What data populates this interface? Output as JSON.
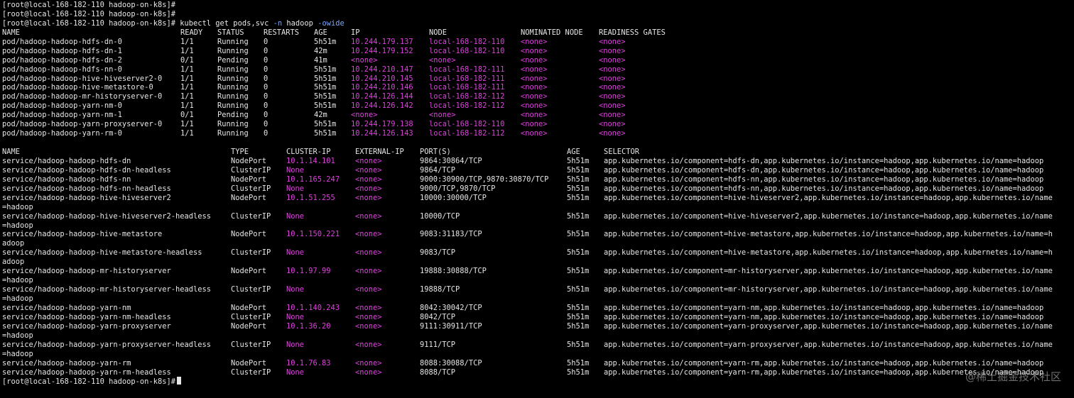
{
  "prompts": {
    "p1": "[root@local-168-182-110 hadoop-on-k8s]#",
    "p2": "[root@local-168-182-110 hadoop-on-k8s]#",
    "p3": "[root@local-168-182-110 hadoop-on-k8s]#",
    "last": "[root@local-168-182-110 hadoop-on-k8s]#"
  },
  "command": {
    "base": " kubectl get pods,svc ",
    "flag1": "-n",
    "arg": " hadoop ",
    "flag2": "-owide"
  },
  "pods": {
    "headers": [
      "NAME",
      "READY",
      "STATUS",
      "RESTARTS",
      "AGE",
      "IP",
      "NODE",
      "NOMINATED NODE",
      "READINESS GATES"
    ],
    "rows": [
      [
        "pod/hadoop-hadoop-hdfs-dn-0",
        "1/1",
        "Running",
        "0",
        "5h51m",
        "10.244.179.137",
        "local-168-182-110",
        "<none>",
        "<none>"
      ],
      [
        "pod/hadoop-hadoop-hdfs-dn-1",
        "1/1",
        "Running",
        "0",
        "42m",
        "10.244.179.152",
        "local-168-182-110",
        "<none>",
        "<none>"
      ],
      [
        "pod/hadoop-hadoop-hdfs-dn-2",
        "0/1",
        "Pending",
        "0",
        "41m",
        "<none>",
        "<none>",
        "<none>",
        "<none>"
      ],
      [
        "pod/hadoop-hadoop-hdfs-nn-0",
        "1/1",
        "Running",
        "0",
        "5h51m",
        "10.244.210.147",
        "local-168-182-111",
        "<none>",
        "<none>"
      ],
      [
        "pod/hadoop-hadoop-hive-hiveserver2-0",
        "1/1",
        "Running",
        "0",
        "5h51m",
        "10.244.210.145",
        "local-168-182-111",
        "<none>",
        "<none>"
      ],
      [
        "pod/hadoop-hadoop-hive-metastore-0",
        "1/1",
        "Running",
        "0",
        "5h51m",
        "10.244.210.146",
        "local-168-182-111",
        "<none>",
        "<none>"
      ],
      [
        "pod/hadoop-hadoop-mr-historyserver-0",
        "1/1",
        "Running",
        "0",
        "5h51m",
        "10.244.126.144",
        "local-168-182-112",
        "<none>",
        "<none>"
      ],
      [
        "pod/hadoop-hadoop-yarn-nm-0",
        "1/1",
        "Running",
        "0",
        "5h51m",
        "10.244.126.142",
        "local-168-182-112",
        "<none>",
        "<none>"
      ],
      [
        "pod/hadoop-hadoop-yarn-nm-1",
        "0/1",
        "Pending",
        "0",
        "42m",
        "<none>",
        "<none>",
        "<none>",
        "<none>"
      ],
      [
        "pod/hadoop-hadoop-yarn-proxyserver-0",
        "1/1",
        "Running",
        "0",
        "5h51m",
        "10.244.179.138",
        "local-168-182-110",
        "<none>",
        "<none>"
      ],
      [
        "pod/hadoop-hadoop-yarn-rm-0",
        "1/1",
        "Running",
        "0",
        "5h51m",
        "10.244.126.143",
        "local-168-182-112",
        "<none>",
        "<none>"
      ]
    ]
  },
  "services": {
    "headers": [
      "NAME",
      "TYPE",
      "CLUSTER-IP",
      "EXTERNAL-IP",
      "PORT(S)",
      "AGE",
      "SELECTOR"
    ],
    "rows": [
      {
        "c": [
          "service/hadoop-hadoop-hdfs-dn",
          "NodePort",
          "10.1.14.101",
          "<none>",
          "9864:30864/TCP",
          "5h51m",
          "app.kubernetes.io/component=hdfs-dn,app.kubernetes.io/instance=hadoop,app.kubernetes.io/name=hadoop"
        ],
        "wrap": ""
      },
      {
        "c": [
          "service/hadoop-hadoop-hdfs-dn-headless",
          "ClusterIP",
          "None",
          "<none>",
          "9864/TCP",
          "5h51m",
          "app.kubernetes.io/component=hdfs-dn,app.kubernetes.io/instance=hadoop,app.kubernetes.io/name=hadoop"
        ],
        "wrap": ""
      },
      {
        "c": [
          "service/hadoop-hadoop-hdfs-nn",
          "NodePort",
          "10.1.165.247",
          "<none>",
          "9000:30900/TCP,9870:30870/TCP",
          "5h51m",
          "app.kubernetes.io/component=hdfs-nn,app.kubernetes.io/instance=hadoop,app.kubernetes.io/name=hadoop"
        ],
        "wrap": ""
      },
      {
        "c": [
          "service/hadoop-hadoop-hdfs-nn-headless",
          "ClusterIP",
          "None",
          "<none>",
          "9000/TCP,9870/TCP",
          "5h51m",
          "app.kubernetes.io/component=hdfs-nn,app.kubernetes.io/instance=hadoop,app.kubernetes.io/name=hadoop"
        ],
        "wrap": ""
      },
      {
        "c": [
          "service/hadoop-hadoop-hive-hiveserver2",
          "NodePort",
          "10.1.51.255",
          "<none>",
          "10000:30000/TCP",
          "5h51m",
          "app.kubernetes.io/component=hive-hiveserver2,app.kubernetes.io/instance=hadoop,app.kubernetes.io/name"
        ],
        "wrap": "=hadoop"
      },
      {
        "c": [
          "service/hadoop-hadoop-hive-hiveserver2-headless",
          "ClusterIP",
          "None",
          "<none>",
          "10000/TCP",
          "5h51m",
          "app.kubernetes.io/component=hive-hiveserver2,app.kubernetes.io/instance=hadoop,app.kubernetes.io/name"
        ],
        "wrap": "=hadoop"
      },
      {
        "c": [
          "service/hadoop-hadoop-hive-metastore",
          "NodePort",
          "10.1.150.221",
          "<none>",
          "9083:31183/TCP",
          "5h51m",
          "app.kubernetes.io/component=hive-metastore,app.kubernetes.io/instance=hadoop,app.kubernetes.io/name=h"
        ],
        "wrap": "adoop"
      },
      {
        "c": [
          "service/hadoop-hadoop-hive-metastore-headless",
          "ClusterIP",
          "None",
          "<none>",
          "9083/TCP",
          "5h51m",
          "app.kubernetes.io/component=hive-metastore,app.kubernetes.io/instance=hadoop,app.kubernetes.io/name=h"
        ],
        "wrap": "adoop"
      },
      {
        "c": [
          "service/hadoop-hadoop-mr-historyserver",
          "NodePort",
          "10.1.97.99",
          "<none>",
          "19888:30888/TCP",
          "5h51m",
          "app.kubernetes.io/component=mr-historyserver,app.kubernetes.io/instance=hadoop,app.kubernetes.io/name"
        ],
        "wrap": "=hadoop"
      },
      {
        "c": [
          "service/hadoop-hadoop-mr-historyserver-headless",
          "ClusterIP",
          "None",
          "<none>",
          "19888/TCP",
          "5h51m",
          "app.kubernetes.io/component=mr-historyserver,app.kubernetes.io/instance=hadoop,app.kubernetes.io/name"
        ],
        "wrap": "=hadoop"
      },
      {
        "c": [
          "service/hadoop-hadoop-yarn-nm",
          "NodePort",
          "10.1.140.243",
          "<none>",
          "8042:30042/TCP",
          "5h51m",
          "app.kubernetes.io/component=yarn-nm,app.kubernetes.io/instance=hadoop,app.kubernetes.io/name=hadoop"
        ],
        "wrap": ""
      },
      {
        "c": [
          "service/hadoop-hadoop-yarn-nm-headless",
          "ClusterIP",
          "None",
          "<none>",
          "8042/TCP",
          "5h51m",
          "app.kubernetes.io/component=yarn-nm,app.kubernetes.io/instance=hadoop,app.kubernetes.io/name=hadoop"
        ],
        "wrap": ""
      },
      {
        "c": [
          "service/hadoop-hadoop-yarn-proxyserver",
          "NodePort",
          "10.1.36.20",
          "<none>",
          "9111:30911/TCP",
          "5h51m",
          "app.kubernetes.io/component=yarn-proxyserver,app.kubernetes.io/instance=hadoop,app.kubernetes.io/name"
        ],
        "wrap": "=hadoop"
      },
      {
        "c": [
          "service/hadoop-hadoop-yarn-proxyserver-headless",
          "ClusterIP",
          "None",
          "<none>",
          "9111/TCP",
          "5h51m",
          "app.kubernetes.io/component=yarn-proxyserver,app.kubernetes.io/instance=hadoop,app.kubernetes.io/name"
        ],
        "wrap": "=hadoop"
      },
      {
        "c": [
          "service/hadoop-hadoop-yarn-rm",
          "NodePort",
          "10.1.76.83",
          "<none>",
          "8088:30088/TCP",
          "5h51m",
          "app.kubernetes.io/component=yarn-rm,app.kubernetes.io/instance=hadoop,app.kubernetes.io/name=hadoop"
        ],
        "wrap": ""
      },
      {
        "c": [
          "service/hadoop-hadoop-yarn-rm-headless",
          "ClusterIP",
          "None",
          "<none>",
          "8088/TCP",
          "5h51m",
          "app.kubernetes.io/component=yarn-rm,app.kubernetes.io/instance=hadoop,app.kubernetes.io/name=hadoop"
        ],
        "wrap": ""
      }
    ]
  },
  "watermark": "@稀土掘金技术社区",
  "colors": {
    "background": "#000000",
    "text": "#e6e6e6",
    "highlight": "#e040e0",
    "flag": "#7aa7ff"
  }
}
